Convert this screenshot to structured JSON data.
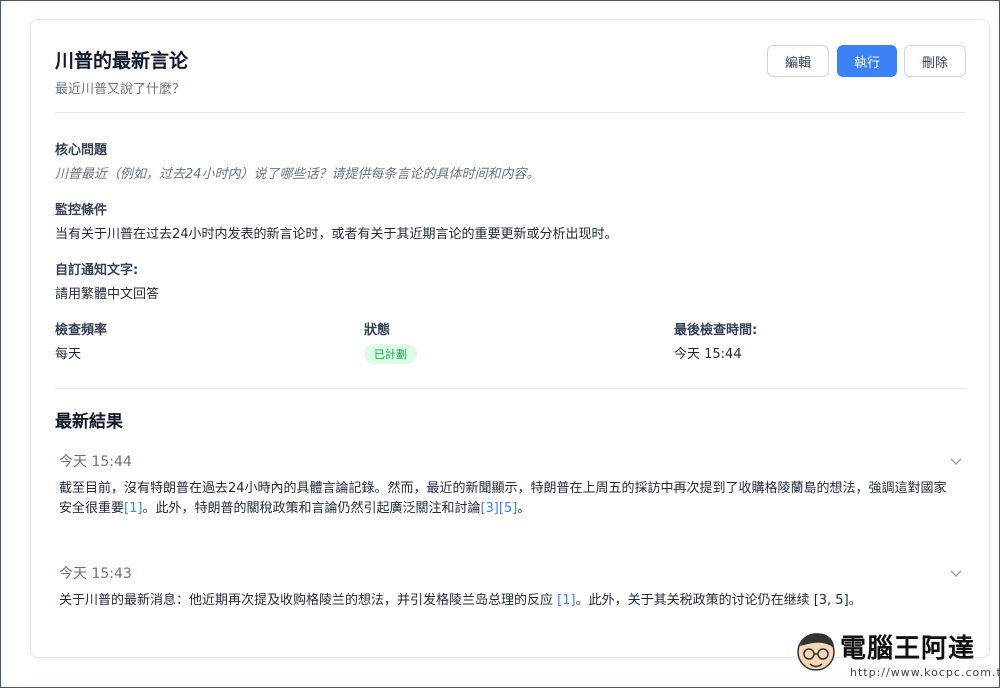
{
  "header": {
    "title": "川普的最新言论",
    "subtitle": "最近川普又說了什麼？",
    "buttons": {
      "edit": "編輯",
      "run": "執行",
      "delete": "刪除"
    }
  },
  "details": {
    "core_question_label": "核心問題",
    "core_question_value": "川普最近（例如，过去24小时内）说了哪些话？请提供每条言论的具体时间和内容。",
    "monitor_label": "監控條件",
    "monitor_value": "当有关于川普在过去24小时内发表的新言论时，或者有关于其近期言论的重要更新或分析出现时。",
    "notify_label": "自訂通知文字:",
    "notify_value": "請用繁體中文回答",
    "frequency_label": "檢查頻率",
    "frequency_value": "每天",
    "status_label": "狀態",
    "status_value": "已計劃",
    "last_check_label": "最後檢查時間:",
    "last_check_value": "今天 15:44"
  },
  "results": {
    "title": "最新結果",
    "items": [
      {
        "time": "今天 15:44",
        "text_a": "截至目前，沒有特朗普在過去24小時內的具體言論記錄。然而，最近的新聞顯示，特朗普在上周五的採訪中再次提到了收購格陵蘭島的想法，強調這對國家安全很重要",
        "ref_a": "[1]",
        "text_b": "。此外，特朗普的關稅政策和言論仍然引起廣泛關注和討論",
        "ref_b": "[3][5]",
        "text_c": "。"
      },
      {
        "time": "今天 15:43",
        "text_a": "关于川普的最新消息：他近期再次提及收购格陵兰的想法，并引发格陵兰岛总理的反应 ",
        "ref_a": "[1]",
        "text_b": "。此外，关于其关税政策的讨论仍在继续 [3, 5]。"
      }
    ]
  },
  "watermark": {
    "brand": "電腦王阿達",
    "url": "http://www.kocpc.com.tw"
  },
  "colors": {
    "accent": "#3b82f6",
    "badge_bg": "#dcfce7",
    "badge_text": "#16a34a"
  }
}
